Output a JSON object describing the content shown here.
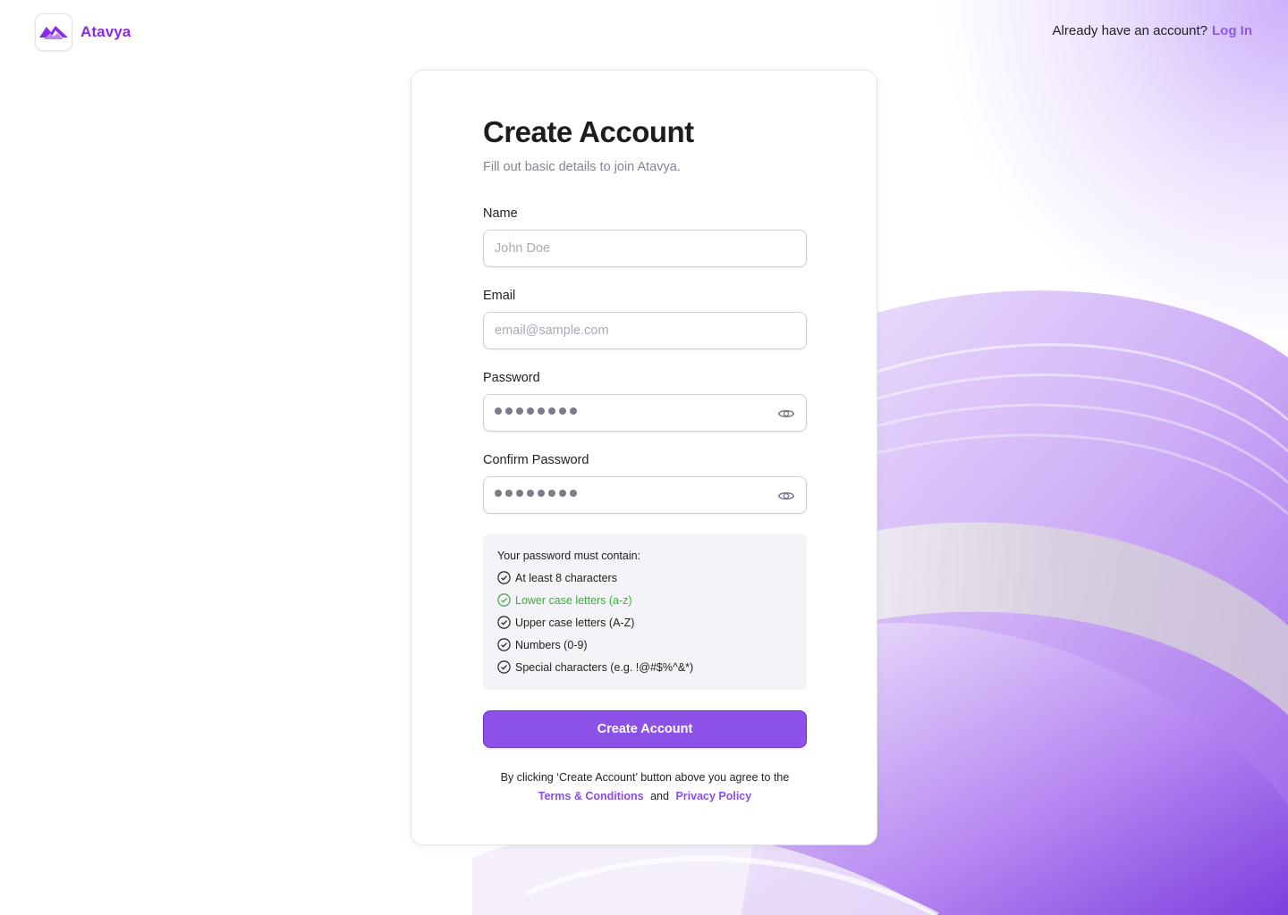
{
  "brand": {
    "name": "Atavya",
    "color": "#8a2be2",
    "logo_icon": "atavya-mountain-logo"
  },
  "header": {
    "prompt": "Already have an account?",
    "login_label": "Log In"
  },
  "form": {
    "title": "Create Account",
    "subtitle": "Fill out basic details to join Atavya.",
    "name": {
      "label": "Name",
      "placeholder": "John Doe",
      "value": ""
    },
    "email": {
      "label": "Email",
      "placeholder": "email@sample.com",
      "value": ""
    },
    "password": {
      "label": "Password",
      "masked_length": 8,
      "toggle_icon": "eye-icon"
    },
    "confirm_password": {
      "label": "Confirm Password",
      "masked_length": 8,
      "toggle_icon": "eye-icon"
    },
    "requirements": {
      "heading": "Your password must contain:",
      "items": [
        {
          "text": "At least 8 characters",
          "met": false
        },
        {
          "text": "Lower case letters (a-z)",
          "met": true
        },
        {
          "text": "Upper case letters (A-Z)",
          "met": false
        },
        {
          "text": "Numbers (0-9)",
          "met": false
        },
        {
          "text": "Special characters (e.g. !@#$%^&*)",
          "met": false
        }
      ]
    },
    "submit_label": "Create Account",
    "terms": {
      "prefix": "By clicking ‘Create Account’ button above you agree to the",
      "terms_label": "Terms & Conditions",
      "conjunction": "and",
      "privacy_label": "Privacy Policy"
    }
  },
  "colors": {
    "accent": "#8c52e8",
    "success": "#3daa3a",
    "link": "#8b5ae6"
  }
}
